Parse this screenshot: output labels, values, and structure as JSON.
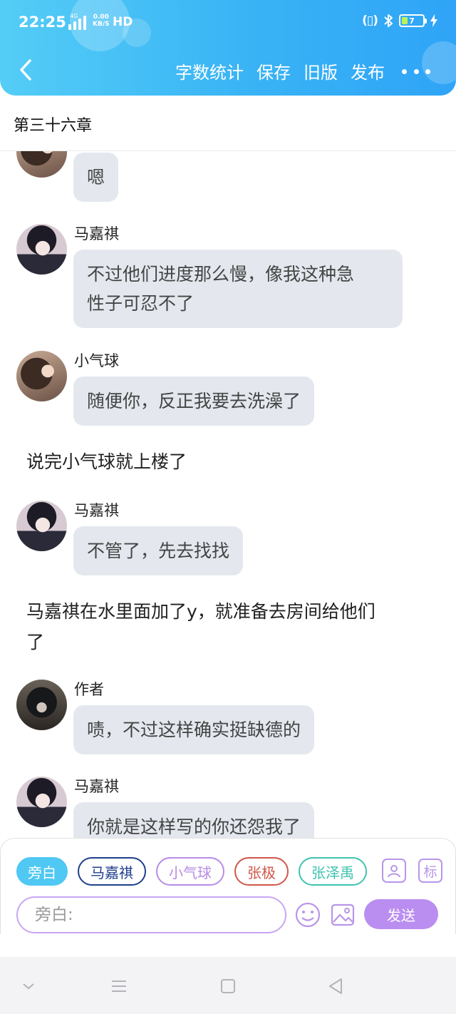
{
  "status_bar": {
    "time": "22:25",
    "network": "4G",
    "speed_value": "0.00",
    "speed_unit": "KB/S",
    "hd_label": "HD",
    "battery_level": "7"
  },
  "header": {
    "actions": [
      "字数统计",
      "保存",
      "旧版",
      "发布"
    ],
    "colors": {
      "gradient_start": "#54cdf6",
      "gradient_end": "#2fa4f7"
    }
  },
  "chapter": {
    "title": "第三十六章"
  },
  "messages": [
    {
      "speaker": "",
      "text": "嗯"
    },
    {
      "speaker": "马嘉祺",
      "text_line1": "不过他们进度那么慢，像我这种急",
      "text_line2": "性子可忍不了"
    },
    {
      "speaker": "小气球",
      "text": "随便你，反正我要去洗澡了"
    },
    {
      "narration": "说完小气球就上楼了"
    },
    {
      "speaker": "马嘉祺",
      "text": "不管了，先去找找"
    },
    {
      "narration_line1": "马嘉祺在水里面加了y，就准备去房间给他们",
      "narration_line2": "了"
    },
    {
      "speaker": "作者",
      "text": "啧，不过这样确实挺缺德的"
    },
    {
      "speaker": "马嘉祺",
      "text": "你就是这样写的你还怨我了"
    }
  ],
  "composer": {
    "roles": [
      {
        "label": "旁白",
        "color": "#4fc8f4",
        "selected": true
      },
      {
        "label": "马嘉祺",
        "color": "#1f3f8c",
        "selected": false
      },
      {
        "label": "小气球",
        "color": "#b88be6",
        "selected": false
      },
      {
        "label": "张极",
        "color": "#d0574a",
        "selected": false
      },
      {
        "label": "张泽禹",
        "color": "#3fc3b0",
        "selected": false
      }
    ],
    "tag_button": "标",
    "input_placeholder": "旁白:",
    "send_label": "发送",
    "accent_color": "#ba8df0"
  }
}
